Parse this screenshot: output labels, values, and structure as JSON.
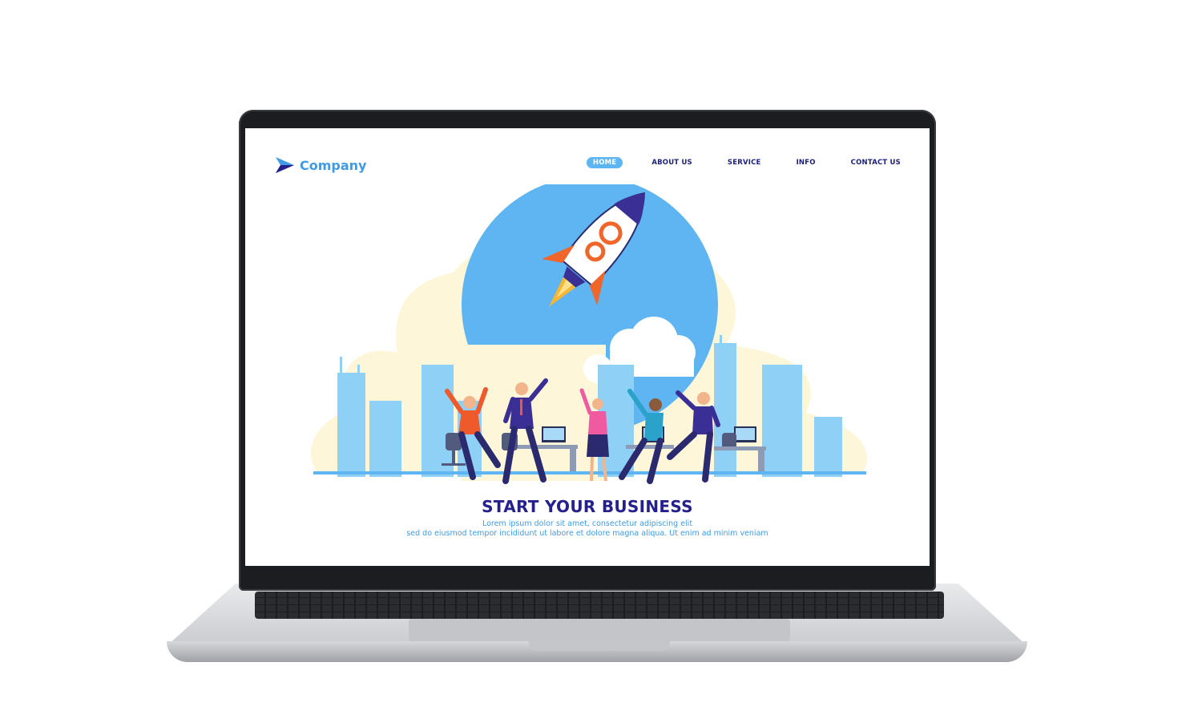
{
  "site": {
    "logo_text": "Company",
    "nav": [
      {
        "label": "HOME",
        "active": true
      },
      {
        "label": "ABOUT US",
        "active": false
      },
      {
        "label": "SERVICE",
        "active": false
      },
      {
        "label": "INFO",
        "active": false
      },
      {
        "label": "CONTACT US",
        "active": false
      }
    ],
    "hero": {
      "illustration": "rocket-launch-team-celebration",
      "headline": "START YOUR BUSINESS",
      "subtext_line1": "Lorem ipsum dolor sit amet, consectetur adipiscing elit",
      "subtext_line2": "sed do eiusmod tempor incididunt ut labore et dolore magna aliqua. Ut enim ad minim veniam"
    }
  },
  "colors": {
    "brand_blue": "#3f9be8",
    "nav_text": "#1d1f7a",
    "nav_active_bg": "#5db5f2",
    "headline": "#25208c",
    "cream": "#fdf6d8",
    "sky_blue": "#5fb4f2",
    "rocket_orange": "#f0652a"
  }
}
